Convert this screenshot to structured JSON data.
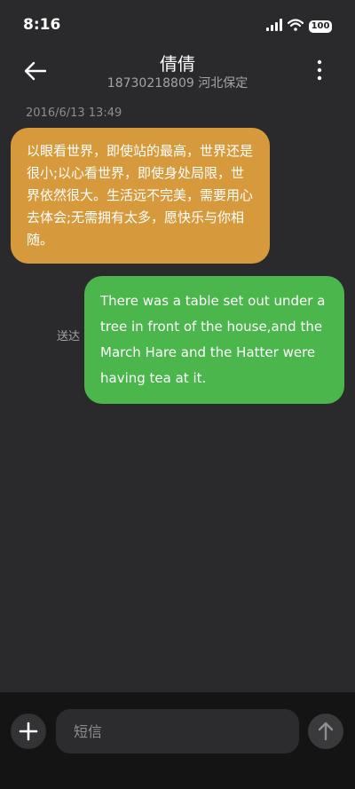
{
  "status_bar": {
    "time": "8:16",
    "battery": "100"
  },
  "header": {
    "contact_name": "倩倩",
    "contact_detail": "18730218809 河北保定"
  },
  "conversation": {
    "timestamp": "2016/6/13 13:49",
    "incoming_message": "以眼看世界，即使站的最高，世界还是很小;以心看世界，即使身处局限，世界依然很大。生活远不完美，需要用心去体会;无需拥有太多，愿快乐与你相随。",
    "outgoing_message": "There was a table set out under a tree in front of the house,and the March Hare and the Hatter were having tea at it.",
    "outgoing_status": "送达"
  },
  "composer": {
    "placeholder": "短信"
  },
  "icons": {
    "back": "back-arrow-icon",
    "more": "more-vertical-icon",
    "add": "plus-icon",
    "send": "arrow-up-icon",
    "signal": "signal-icon",
    "wifi": "wifi-icon"
  },
  "colors": {
    "background": "#2a2a2c",
    "incoming_bubble": "#d69a3d",
    "outgoing_bubble": "#4ab64b",
    "composer_background": "#141414"
  }
}
